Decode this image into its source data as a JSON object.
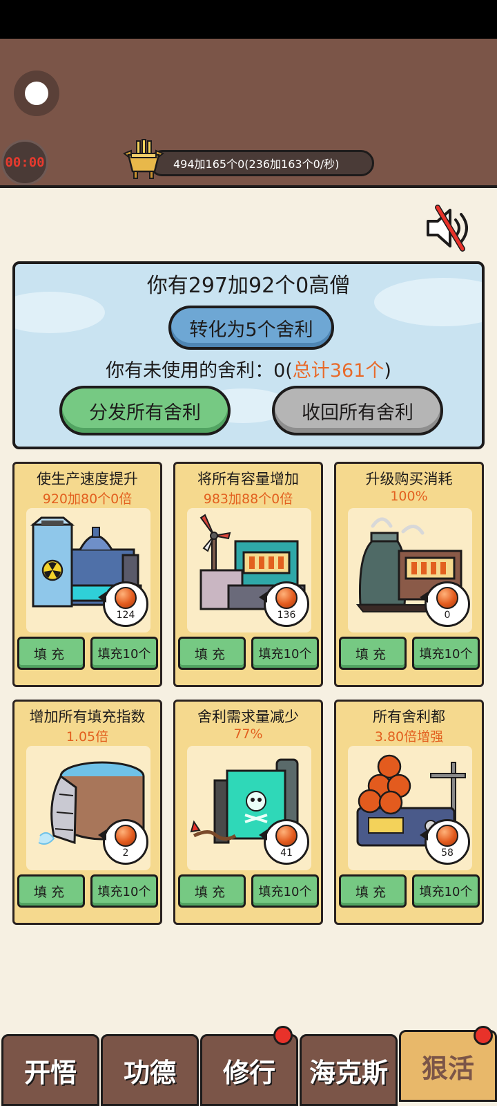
{
  "header": {
    "timer": "00:00",
    "resource_text": "494加165个0(236加163个0/秒)"
  },
  "panel": {
    "monks_text": "你有297加92个0高僧",
    "convert_label": "转化为5个舍利",
    "unused_prefix": "你有未使用的舍利：0(",
    "unused_total": "总计361个",
    "unused_suffix": ")",
    "distribute_label": "分发所有舍利",
    "recall_label": "收回所有舍利"
  },
  "cards": [
    {
      "title": "使生产速度提升",
      "value": "920加80个0倍",
      "count": "124",
      "fill_label": "填充",
      "fill10_label": "填充10个",
      "icon": "nuclear-plant-icon"
    },
    {
      "title": "将所有容量增加",
      "value": "983加88个0倍",
      "count": "136",
      "fill_label": "填充",
      "fill10_label": "填充10个",
      "icon": "wind-generator-icon"
    },
    {
      "title": "升级购买消耗",
      "value": "100%",
      "count": "0",
      "fill_label": "填充",
      "fill10_label": "填充10个",
      "icon": "furnace-icon"
    },
    {
      "title": "增加所有填充指数",
      "value": "1.05倍",
      "count": "2",
      "fill_label": "填充",
      "fill10_label": "填充10个",
      "icon": "dam-icon"
    },
    {
      "title": "舍利需求量减少",
      "value": "77%",
      "count": "41",
      "fill_label": "填充",
      "fill10_label": "填充10个",
      "icon": "toxic-tank-icon"
    },
    {
      "title": "所有舍利都",
      "value": "3.80倍增强",
      "count": "58",
      "fill_label": "填充",
      "fill10_label": "填充10个",
      "icon": "relic-scale-icon"
    }
  ],
  "tabs": [
    {
      "label": "开悟",
      "active": false,
      "badge": false
    },
    {
      "label": "功德",
      "active": false,
      "badge": false
    },
    {
      "label": "修行",
      "active": false,
      "badge": true
    },
    {
      "label": "海克斯",
      "active": false,
      "badge": false
    },
    {
      "label": "狠活",
      "active": true,
      "badge": true
    }
  ],
  "colors": {
    "header_bg": "#7b5548",
    "panel_bg": "#c9e3f1",
    "card_bg": "#f5d98e",
    "green_button": "#76c983",
    "accent_orange": "#e2601f",
    "badge_red": "#e8322a"
  }
}
